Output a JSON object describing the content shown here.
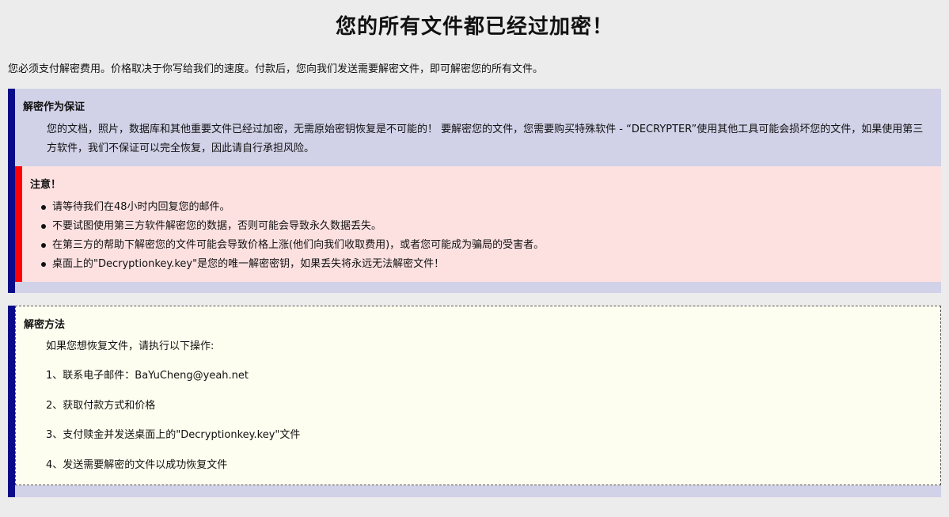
{
  "title": "您的所有文件都已经过加密！",
  "intro": "您必须支付解密费用。价格取决于你写给我们的速度。付款后，您向我们发送需要解密文件，即可解密您的所有文件。",
  "guarantee": {
    "heading": "解密作为保证",
    "text": "您的文档，照片，数据库和其他重要文件已经过加密，无需原始密钥恢复是不可能的！ 要解密您的文件，您需要购买特殊软件 - “DECRYPTER”使用其他工具可能会损坏您的文件，如果使用第三方软件，我们不保证可以完全恢复，因此请自行承担风险。"
  },
  "notice": {
    "heading": "注意！",
    "items": [
      "请等待我们在48小时内回复您的邮件。",
      "不要试图使用第三方软件解密您的数据，否则可能会导致永久数据丢失。",
      "在第三方的帮助下解密您的文件可能会导致价格上涨(他们向我们收取费用)，或者您可能成为骗局的受害者。",
      "桌面上的\"Decryptionkey.key\"是您的唯一解密密钥，如果丢失将永远无法解密文件！"
    ]
  },
  "method": {
    "heading": "解密方法",
    "intro": "如果您想恢复文件，请执行以下操作:",
    "steps": [
      "1、联系电子邮件：BaYuCheng@yeah.net",
      "2、获取付款方式和价格",
      "3、支付赎金并发送桌面上的\"Decryptionkey.key\"文件",
      "4、发送需要解密的文件以成功恢复文件"
    ]
  },
  "colors": {
    "page_background": "#ececec",
    "panel_background": "#d1d1e8",
    "panel_accent": "#0a0a8a",
    "notice_background": "#fde1e1",
    "notice_accent": "#ff0000",
    "method_background": "#fefef0"
  }
}
